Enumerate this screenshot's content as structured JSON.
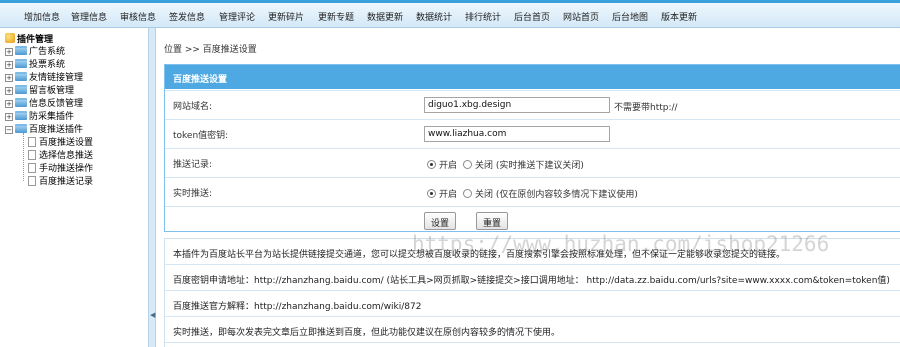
{
  "topnav": {
    "items": [
      "增加信息",
      "管理信息",
      "审核信息",
      "签发信息",
      "管理评论",
      "更新碎片",
      "更新专题",
      "数据更新",
      "数据统计",
      "排行统计",
      "后台首页",
      "网站首页",
      "后台地图",
      "版本更新"
    ]
  },
  "sidebar": {
    "title": "插件管理",
    "folders": [
      "广告系统",
      "投票系统",
      "友情链接管理",
      "留言板管理",
      "信息反馈管理",
      "防采集插件",
      "百度推送插件"
    ],
    "children": [
      "百度推送设置",
      "选择信息推送",
      "手动推送操作",
      "百度推送记录"
    ]
  },
  "breadcrumb": "位置 >> 百度推送设置",
  "form": {
    "header": "百度推送设置",
    "domain_label": "网站域名:",
    "domain_value": "diguo1.xbg.design",
    "domain_hint": "不需要带http://",
    "token_label": "token值密钥:",
    "token_value": "www.liazhua.com",
    "record_label": "推送记录:",
    "record_on": "开启",
    "record_off": "关闭 (实时推送下建议关闭)",
    "realtime_label": "实时推送:",
    "realtime_on": "开启",
    "realtime_off": "关闭 (仅在原创内容较多情况下建议使用)",
    "submit": "设置",
    "reset": "重置"
  },
  "info": [
    "本插件为百度站长平台为站长提供链接提交通道，您可以提交想被百度收录的链接，百度搜索引擎会按照标准处理，但不保证一定能够收录您提交的链接。",
    "百度密钥申请地址：http://zhanzhang.baidu.com/ (站长工具>网页抓取>链接提交>接口调用地址： http://data.zz.baidu.com/urls?site=www.xxxx.com&token=token值)",
    "百度推送官方解释：http://zhanzhang.baidu.com/wiki/872",
    "实时推送，即每次发表完文章后立即推送到百度，但此功能仅建议在原创内容较多的情况下使用。"
  ],
  "watermark": "https://www.huzhan.com/ishop21266"
}
